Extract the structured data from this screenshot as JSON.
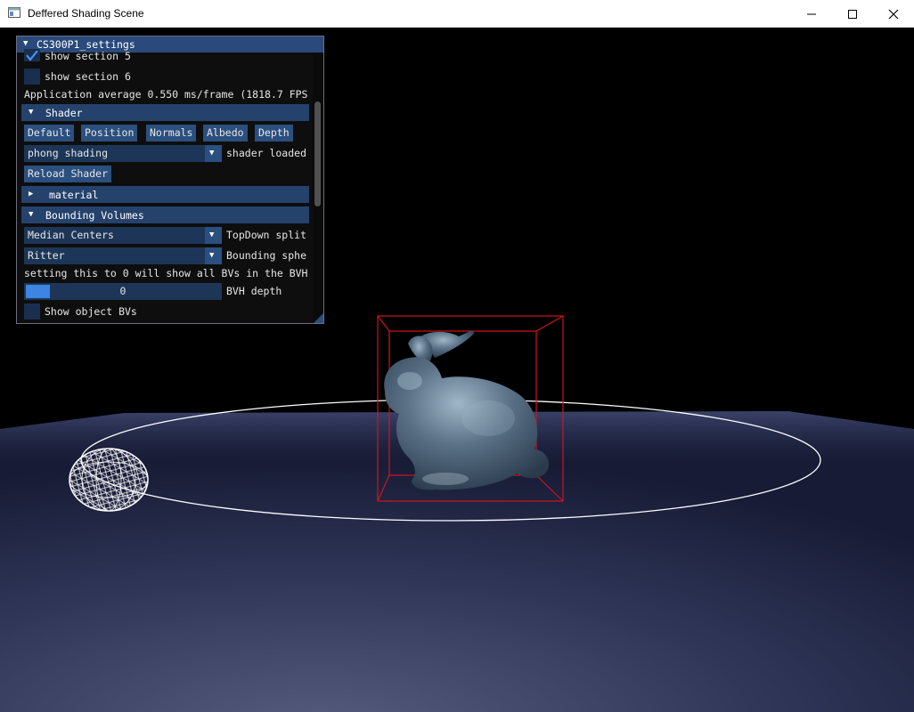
{
  "window": {
    "title": "Deffered Shading Scene",
    "icons": {
      "app": "app-window-icon",
      "minimize": "minimize-icon",
      "maximize": "maximize-icon",
      "close": "close-icon"
    }
  },
  "panel": {
    "title": "CS300P1_settings",
    "show_section_5": {
      "label": "show section 5",
      "checked": true
    },
    "show_section_6": {
      "label": "show section 6",
      "checked": false
    },
    "fps_text": "Application average 0.550 ms/frame (1818.7 FPS",
    "shader": {
      "header": "Shader",
      "buttons": [
        "Default",
        "Position",
        "Normals",
        "Albedo",
        "Depth"
      ],
      "combo_value": "phong shading",
      "combo_label": "shader loaded",
      "reload_button": "Reload Shader"
    },
    "material": {
      "header": "material",
      "expanded": false
    },
    "bounding_volumes": {
      "header": "Bounding Volumes",
      "split_value": "Median Centers",
      "split_label": "TopDown split",
      "sphere_value": "Ritter",
      "sphere_label": "Bounding sphe",
      "hint": "setting this to 0 will show all BVs in the BVH",
      "depth_value": "0",
      "depth_label": "BVH depth",
      "show_object_bvs": {
        "label": "Show object BVs",
        "checked": false
      }
    }
  },
  "scene": {
    "colors": {
      "background": "#000000",
      "floor": "#3a4266",
      "bunny": "#5b7288",
      "bbox": "#d0141e",
      "orbit": "#ffffff"
    }
  }
}
